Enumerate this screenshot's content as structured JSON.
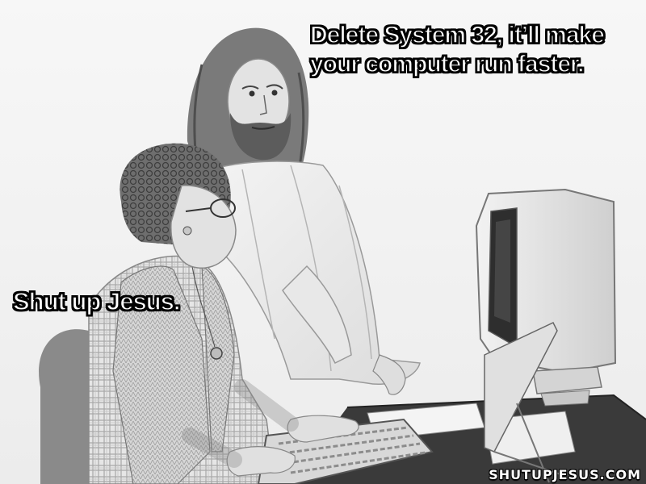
{
  "meme": {
    "caption_top_lines": [
      "Delete System 32, it’ll make",
      "your computer run faster."
    ],
    "caption_left": "Shut up Jesus.",
    "watermark": "SHUTUPJESUS.COM"
  },
  "scene": {
    "style": "pencil-sketch",
    "subjects": [
      "woman-at-computer",
      "jesus-figure",
      "crt-monitor",
      "keyboard"
    ]
  }
}
